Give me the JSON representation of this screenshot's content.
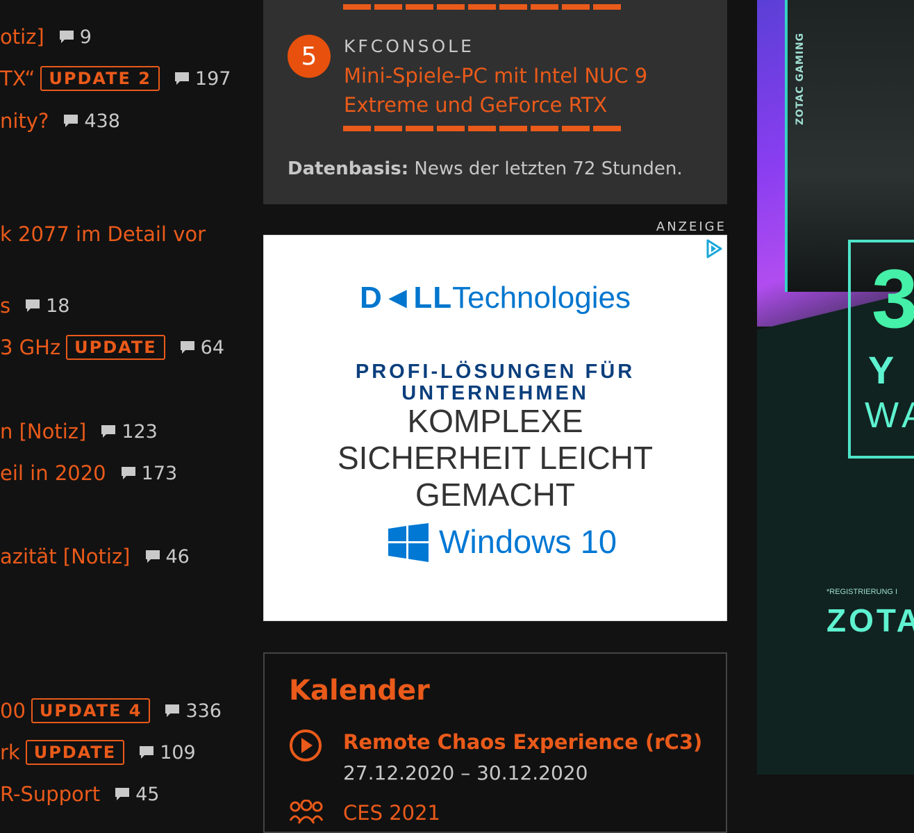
{
  "news_list": [
    {
      "title": "otiz]",
      "update": "",
      "comments": "9"
    },
    {
      "title": "TX“",
      "update": "UPDATE 2",
      "comments": "197"
    },
    {
      "title": "nity?",
      "update": "",
      "comments": "438"
    },
    {
      "title": "k 2077 im Detail vor",
      "update": "",
      "comments": ""
    },
    {
      "title": "s",
      "update": "",
      "comments": "18"
    },
    {
      "title": "3 GHz",
      "update": "UPDATE",
      "comments": "64"
    },
    {
      "title": "n [Notiz]",
      "update": "",
      "comments": "123"
    },
    {
      "title": "eil in 2020",
      "update": "",
      "comments": "173"
    },
    {
      "title": "azität [Notiz]",
      "update": "",
      "comments": "46"
    },
    {
      "title": "00",
      "update": "UPDATE 4",
      "comments": "336"
    },
    {
      "title": "rk",
      "update": "UPDATE",
      "comments": "109"
    },
    {
      "title": "R-Support",
      "update": "",
      "comments": "45"
    }
  ],
  "ranking": {
    "rank": "5",
    "category": "KFCONSOLE",
    "title": "Mini-Spiele-PC mit Intel NUC 9 Extreme und GeForce RTX",
    "datenbasis_label": "Datenbasis:",
    "datenbasis_text": "News der letzten 72 Stunden."
  },
  "ad": {
    "label": "ANZEIGE",
    "brand_bold": "D◄LL",
    "brand_light": "Technologies",
    "headline": "PROFI-LÖSUNGEN FÜR UNTERNEHMEN",
    "subline": "KOMPLEXE SICHERHEIT LEICHT GEMACHT",
    "product": "Windows 10"
  },
  "kalender": {
    "heading": "Kalender",
    "events": [
      {
        "name": "Remote Chaos Experience (rC3)",
        "date": "27.12.2020 – 30.12.2020",
        "icon": "play-circle-icon"
      },
      {
        "name": "CES 2021",
        "date": "",
        "icon": "people-group-icon"
      }
    ]
  },
  "side_ad": {
    "vertical_label": "ZOTAC GAMING",
    "badge_big": "3",
    "badge_mid": "Y",
    "badge_low": "WA",
    "note": "*REGISTRIERUNG I",
    "brand": "ZOTA"
  },
  "colors": {
    "accent": "#ea5a1a",
    "panel": "#303030",
    "background": "#121212"
  }
}
